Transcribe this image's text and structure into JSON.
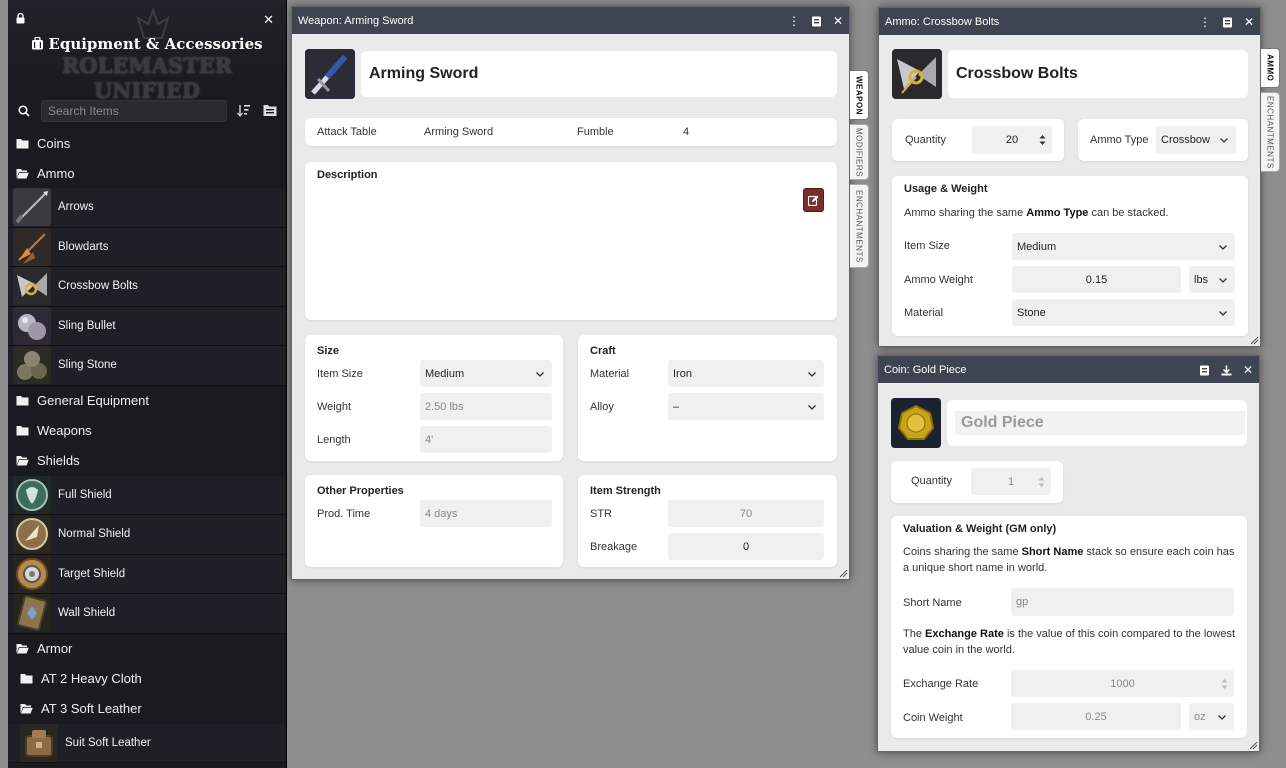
{
  "sidebar": {
    "title": "Equipment & Accessories",
    "logo_text": "ROLEMASTER UNIFIED",
    "search_placeholder": "Search Items",
    "tree": [
      {
        "type": "folder",
        "label": "Coins"
      },
      {
        "type": "folder-open",
        "label": "Ammo"
      },
      {
        "type": "item",
        "label": "Arrows",
        "icon": "arrows-icon"
      },
      {
        "type": "item",
        "label": "Blowdarts",
        "icon": "blowdarts-icon"
      },
      {
        "type": "item",
        "label": "Crossbow Bolts",
        "icon": "crossbow-bolts-icon"
      },
      {
        "type": "item",
        "label": "Sling Bullet",
        "icon": "sling-bullet-icon"
      },
      {
        "type": "item",
        "label": "Sling Stone",
        "icon": "sling-stone-icon"
      },
      {
        "type": "folder",
        "label": "General Equipment"
      },
      {
        "type": "folder",
        "label": "Weapons"
      },
      {
        "type": "folder-open",
        "label": "Shields"
      },
      {
        "type": "item",
        "label": "Full Shield",
        "icon": "full-shield-icon"
      },
      {
        "type": "item",
        "label": "Normal Shield",
        "icon": "normal-shield-icon"
      },
      {
        "type": "item",
        "label": "Target Shield",
        "icon": "target-shield-icon"
      },
      {
        "type": "item",
        "label": "Wall Shield",
        "icon": "wall-shield-icon"
      },
      {
        "type": "folder-open",
        "label": "Armor"
      },
      {
        "type": "subfolder",
        "label": "AT 2 Heavy Cloth"
      },
      {
        "type": "subfolder-open",
        "label": "AT 3 Soft Leather"
      },
      {
        "type": "subitem",
        "label": "Suit Soft Leather",
        "icon": "suit-soft-leather-icon"
      }
    ]
  },
  "weapon": {
    "window_title": "Weapon: Arming Sword",
    "name": "Arming Sword",
    "attack_table_label": "Attack Table",
    "attack_table_value": "Arming Sword",
    "fumble_label": "Fumble",
    "fumble_value": "4",
    "description_title": "Description",
    "tabs": [
      "WEAPON",
      "MODIFIERS",
      "ENCHANTMENTS"
    ],
    "size": {
      "title": "Size",
      "item_size_label": "Item Size",
      "item_size_value": "Medium",
      "weight_label": "Weight",
      "weight_value": "2.50 lbs",
      "length_label": "Length",
      "length_value": "4'"
    },
    "craft": {
      "title": "Craft",
      "material_label": "Material",
      "material_value": "Iron",
      "alloy_label": "Alloy",
      "alloy_value": "–"
    },
    "other": {
      "title": "Other Properties",
      "prod_time_label": "Prod. Time",
      "prod_time_value": "4 days"
    },
    "strength": {
      "title": "Item Strength",
      "str_label": "STR",
      "str_value": "70",
      "breakage_label": "Breakage",
      "breakage_value": "0"
    }
  },
  "ammo": {
    "window_title": "Ammo: Crossbow Bolts",
    "name": "Crossbow Bolts",
    "quantity_label": "Quantity",
    "quantity_value": "20",
    "ammo_type_label": "Ammo Type",
    "ammo_type_value": "Crossbow",
    "tabs": [
      "AMMO",
      "ENCHANTMENTS"
    ],
    "usage": {
      "title": "Usage & Weight",
      "hint_pre": "Ammo sharing the same ",
      "hint_bold": "Ammo Type",
      "hint_post": " can be stacked.",
      "item_size_label": "Item Size",
      "item_size_value": "Medium",
      "ammo_weight_label": "Ammo Weight",
      "ammo_weight_value": "0.15",
      "ammo_weight_unit": "lbs",
      "material_label": "Material",
      "material_value": "Stone"
    }
  },
  "coin": {
    "window_title": "Coin: Gold Piece",
    "name": "Gold Piece",
    "quantity_label": "Quantity",
    "quantity_value": "1",
    "valuation": {
      "title": "Valuation & Weight (GM only)",
      "hint1_pre": "Coins sharing the same ",
      "hint1_bold": "Short Name",
      "hint1_post": " stack so ensure each coin has a unique short name in world.",
      "short_name_label": "Short Name",
      "short_name_value": "gp",
      "hint2_pre": "The ",
      "hint2_bold": "Exchange Rate",
      "hint2_post": " is the value of this coin compared to the lowest value coin in the world.",
      "exchange_rate_label": "Exchange Rate",
      "exchange_rate_value": "1000",
      "coin_weight_label": "Coin Weight",
      "coin_weight_value": "0.25",
      "coin_weight_unit": "oz"
    }
  },
  "colors": {
    "sidebar_bg": "#1a1b21",
    "window_header": "#3f4452",
    "window_body": "#eaeaea",
    "edit_button": "#7a2e2e",
    "desktop": "#8e8e8e"
  }
}
